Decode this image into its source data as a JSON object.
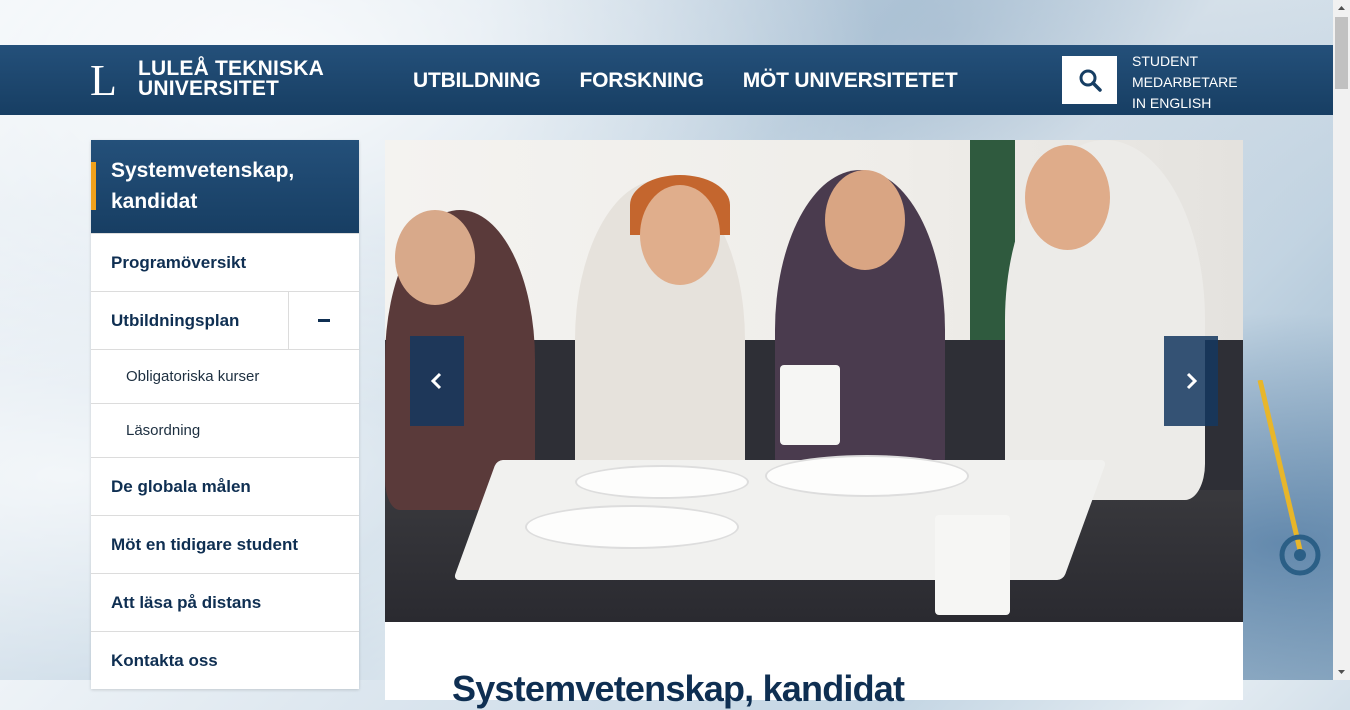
{
  "header": {
    "logo_mark": "L",
    "logo_line1": "LULEÅ TEKNISKA",
    "logo_line2": "UNIVERSITET",
    "nav": [
      "UTBILDNING",
      "FORSKNING",
      "MÖT UNIVERSITETET"
    ],
    "quick_links": [
      "STUDENT",
      "MEDARBETARE",
      "IN ENGLISH"
    ],
    "search_icon": "search-icon"
  },
  "sidebar": {
    "title": "Systemvetenskap, kandidat",
    "items": [
      {
        "label": "Programöversikt",
        "level": 1
      },
      {
        "label": "Utbildningsplan",
        "level": 1,
        "toggle": "minus-icon"
      },
      {
        "label": "Obligatoriska kurser",
        "level": 2
      },
      {
        "label": "Läsordning",
        "level": 2
      },
      {
        "label": "De globala målen",
        "level": 1
      },
      {
        "label": "Möt en tidigare student",
        "level": 1
      },
      {
        "label": "Att läsa på distans",
        "level": 1
      },
      {
        "label": "Kontakta oss",
        "level": 1
      }
    ]
  },
  "main": {
    "slider_prev_icon": "chevron-left-icon",
    "slider_next_icon": "chevron-right-icon",
    "title": "Systemvetenskap, kandidat"
  },
  "colors": {
    "brand_dark": "#173e63",
    "accent": "#f0a11c",
    "text_dark": "#0f2f52"
  }
}
